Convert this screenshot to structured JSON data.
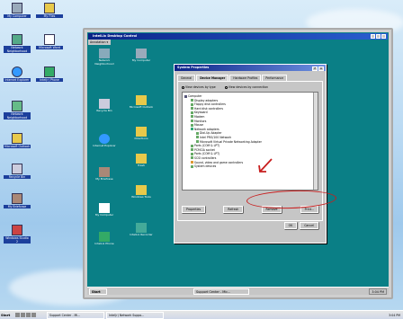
{
  "desktop_icons": [
    {
      "label": "My Computer"
    },
    {
      "label": "My Files"
    },
    {
      "label": "Network Neighborhood"
    },
    {
      "label": "Microsoft Word"
    },
    {
      "label": "Internet Explorer"
    },
    {
      "label": "Intel(r) Phone"
    },
    {
      "label": "Network Neighborhood"
    },
    {
      "label": "Microsoft Outlook"
    },
    {
      "label": "Recycle Bin"
    },
    {
      "label": "My Briefcase"
    },
    {
      "label": "Windows Studio 2"
    }
  ],
  "remote": {
    "window_title": "IntelLix Desktop Control",
    "menu": "Annotation ▾",
    "icons": [
      "Network Neighborhood",
      "My Computer",
      "Microsoft Outlook",
      "Recycle Bin",
      "Directions",
      "Internet Explorer",
      "Trash",
      "My Briefcase",
      "Windows Tools",
      "My Computer",
      "IntelLix Phone",
      "IntelLix Recorder"
    ],
    "taskbar": {
      "start": "Start",
      "task": "Support Center - Mic...",
      "tray": "3:04 PM"
    }
  },
  "dialog": {
    "title": "System Properties",
    "title_btns": [
      "?",
      "×"
    ],
    "tabs": [
      "General",
      "Device Manager",
      "Hardware Profiles",
      "Performance"
    ],
    "radio_type": "View devices by type",
    "radio_conn": "View devices by connection",
    "tree": [
      "Computer",
      "Display adapters",
      "Floppy disk controllers",
      "Hard disk controllers",
      "Keyboard",
      "Modem",
      "Monitors",
      "Mouse",
      "Network adapters",
      "Dial-Up Adapter",
      "Intel PRO/100 Network",
      "Microsoft Virtual Private Networking Adapter",
      "Ports (COM & LPT)",
      "PCMCIA socket",
      "Ports (COM & LPT)",
      "SCSI controllers",
      "Sound, video and game controllers",
      "System devices"
    ],
    "buttons": [
      "Properties",
      "Refresh",
      "Remove",
      "Print..."
    ],
    "ok": "OK",
    "cancel": "Cancel"
  },
  "outer_taskbar": {
    "start": "Start",
    "tasks": [
      "Support Center - Mi...",
      "Intel(r) Network Suppo..."
    ],
    "clock": "3:04 PM"
  },
  "colors": {
    "accent": "#0b2387",
    "annotation": "#c81e1e",
    "remote_bg": "#0a7f86"
  }
}
